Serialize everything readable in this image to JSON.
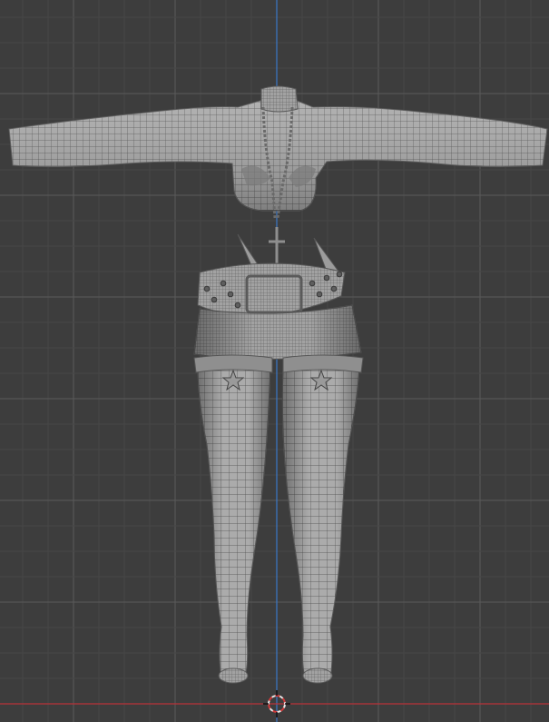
{
  "viewport": {
    "view": "front-orthographic",
    "grid_visible": true,
    "show_wireframe": true,
    "axes": {
      "z_axis_color": "#3a78c8",
      "x_axis_color": "#b8323a"
    }
  },
  "scene": {
    "objects": [
      {
        "name": "cropped-top",
        "icon": "mesh-icon"
      },
      {
        "name": "chain-necklace",
        "icon": "mesh-icon"
      },
      {
        "name": "cross-pendant",
        "icon": "mesh-icon"
      },
      {
        "name": "studded-belt",
        "icon": "mesh-icon"
      },
      {
        "name": "mini-skirt",
        "icon": "mesh-icon"
      },
      {
        "name": "star-garters",
        "icon": "mesh-icon"
      },
      {
        "name": "thigh-high-stockings",
        "icon": "mesh-icon"
      }
    ]
  },
  "cursor": {
    "icon": "3d-cursor-icon"
  },
  "colors": {
    "background": "#3d3d3d",
    "grid_minor": "#464646",
    "grid_major": "#5a5a5a",
    "mesh_fill": "#a8a8a8",
    "mesh_shadow": "#7a7a7a",
    "wire": "#4a4a4a"
  }
}
